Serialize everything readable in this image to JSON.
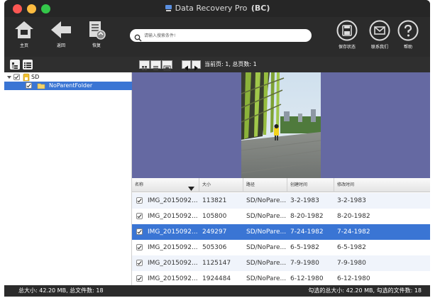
{
  "window": {
    "title": "Data Recovery Pro",
    "title_suffix": "(BC)"
  },
  "toolbar": {
    "home_label": "主页",
    "back_label": "返回",
    "recover_label": "恢复",
    "save_state_label": "保存状态",
    "contact_label": "联系我们",
    "help_label": "帮助",
    "search_placeholder": "请输入搜索条件!"
  },
  "tree": {
    "root_label": "SD",
    "child_label": "NoParentFolder"
  },
  "view": {
    "page_info": "当前页: 1, 总页数: 1"
  },
  "table": {
    "columns": [
      "名称",
      "大小",
      "路径",
      "创建时间",
      "修改时间"
    ],
    "rows": [
      {
        "name": "IMG_2015092...",
        "size": "113821",
        "path": "SD/NoPare...",
        "created": "3-2-1983",
        "modified": "3-2-1983"
      },
      {
        "name": "IMG_2015092...",
        "size": "105800",
        "path": "SD/NoPare...",
        "created": "8-20-1982",
        "modified": "8-20-1982"
      },
      {
        "name": "IMG_2015092...",
        "size": "249297",
        "path": "SD/NoPare...",
        "created": "7-24-1982",
        "modified": "7-24-1982"
      },
      {
        "name": "IMG_2015092...",
        "size": "505306",
        "path": "SD/NoPare...",
        "created": "6-5-1982",
        "modified": "6-5-1982"
      },
      {
        "name": "IMG_2015092...",
        "size": "1125147",
        "path": "SD/NoPare...",
        "created": "7-9-1980",
        "modified": "7-9-1980"
      },
      {
        "name": "IMG_2015092...",
        "size": "1924484",
        "path": "SD/NoPare...",
        "created": "6-12-1980",
        "modified": "6-12-1980"
      }
    ],
    "selected_row": 2
  },
  "status": {
    "left": "总大小: 42.20 MB, 总文件数: 18",
    "right": "勾选的总大小: 42.20 MB,  勾选的文件数: 18"
  },
  "colors": {
    "accent": "#3a75d4",
    "preview_bg": "#6569a2",
    "chrome": "#2b2b2b"
  },
  "icons": {
    "home": "home-icon",
    "back": "back-arrow-icon",
    "recover": "recover-document-icon",
    "save": "floppy-disk-icon",
    "contact": "envelope-icon",
    "help": "question-mark-icon",
    "search": "search-icon"
  }
}
